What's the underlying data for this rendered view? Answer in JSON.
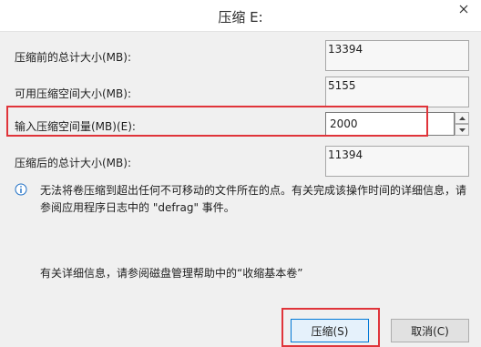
{
  "window": {
    "title": "压缩 E:",
    "close_icon": "close-icon"
  },
  "fields": {
    "total_before_label": "压缩前的总计大小(MB):",
    "total_before_value": "13394",
    "available_label": "可用压缩空间大小(MB):",
    "available_value": "5155",
    "shrink_amount_label": "输入压缩空间量(MB)(E):",
    "shrink_amount_value": "2000",
    "total_after_label": "压缩后的总计大小(MB):",
    "total_after_value": "11394"
  },
  "info": {
    "icon": "info-icon",
    "text": "无法将卷压缩到超出任何不可移动的文件所在的点。有关完成该操作时间的详细信息，请参阅应用程序日志中的 \"defrag\" 事件。"
  },
  "help": {
    "text": "有关详细信息，请参阅磁盘管理帮助中的“收缩基本卷”"
  },
  "buttons": {
    "shrink_label": "压缩(S)",
    "cancel_label": "取消(C)"
  },
  "colors": {
    "highlight": "#e0343a",
    "primary_border": "#0078d7"
  }
}
